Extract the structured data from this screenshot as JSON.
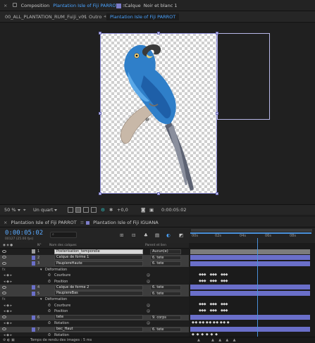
{
  "comp_panel": {
    "composition_label": "Composition",
    "composition_name": "Plantation Isle of Fiji PARROT",
    "layer_tab_label": "Calque",
    "layer_tab_name": "Noir et blanc 1"
  },
  "breadcrumbs": [
    "00_ALL_PLANTATION_RUM_Fuiji_v01",
    "Outro",
    "Plantation Isle of Fiji PARROT"
  ],
  "viewer_toolbar": {
    "zoom": "50 %",
    "resolution": "Un quart",
    "exposure": "+0,0",
    "timecode": "0:00:05:02"
  },
  "timeline": {
    "tabs": [
      "Plantation Isle of Fiji PARROT",
      "Plantation Isle of Fiji IGUANA"
    ],
    "current_time": "0:00:05:02",
    "fps_info": "00127 (25.00 fps)",
    "ruler_labels": [
      "00s",
      "02s",
      "04s",
      "06s",
      "08s"
    ],
    "columns": {
      "number": "N°",
      "layer_name": "Nom des calques",
      "parent": "Parent et lien"
    },
    "layers": [
      {
        "num": "1",
        "name": "Posterisation_temporelle",
        "parent": "Aucun(e)",
        "light": true
      },
      {
        "num": "2",
        "name": "Calque de forme 1",
        "parent": "6. tete",
        "light": false
      },
      {
        "num": "3",
        "name": "PaupiereHaute",
        "parent": "6. tete",
        "light": false
      },
      {
        "sub": "Déformation"
      },
      {
        "sub": "Courbure"
      },
      {
        "sub": "Position"
      },
      {
        "num": "4",
        "name": "Calque de forme 2",
        "parent": "6. tete",
        "light": false
      },
      {
        "num": "5",
        "name": "PaupiereBas",
        "parent": "6. tete",
        "light": false
      },
      {
        "sub": "Déformation"
      },
      {
        "sub": "Courbure"
      },
      {
        "sub": "Position"
      },
      {
        "num": "6",
        "name": "tete",
        "parent": "9. corps",
        "light": false
      },
      {
        "sub": "Rotation"
      },
      {
        "num": "7",
        "name": "bec_Haut",
        "parent": "6. tete",
        "light": false
      },
      {
        "sub": "Rotation"
      }
    ]
  },
  "status_bar": {
    "render_time": "Temps de rendu des images : 5 ms"
  },
  "colors": {
    "accent": "#4aa3ff",
    "layer_bar": "#6a6fc9",
    "cti": "#4a90d9"
  }
}
